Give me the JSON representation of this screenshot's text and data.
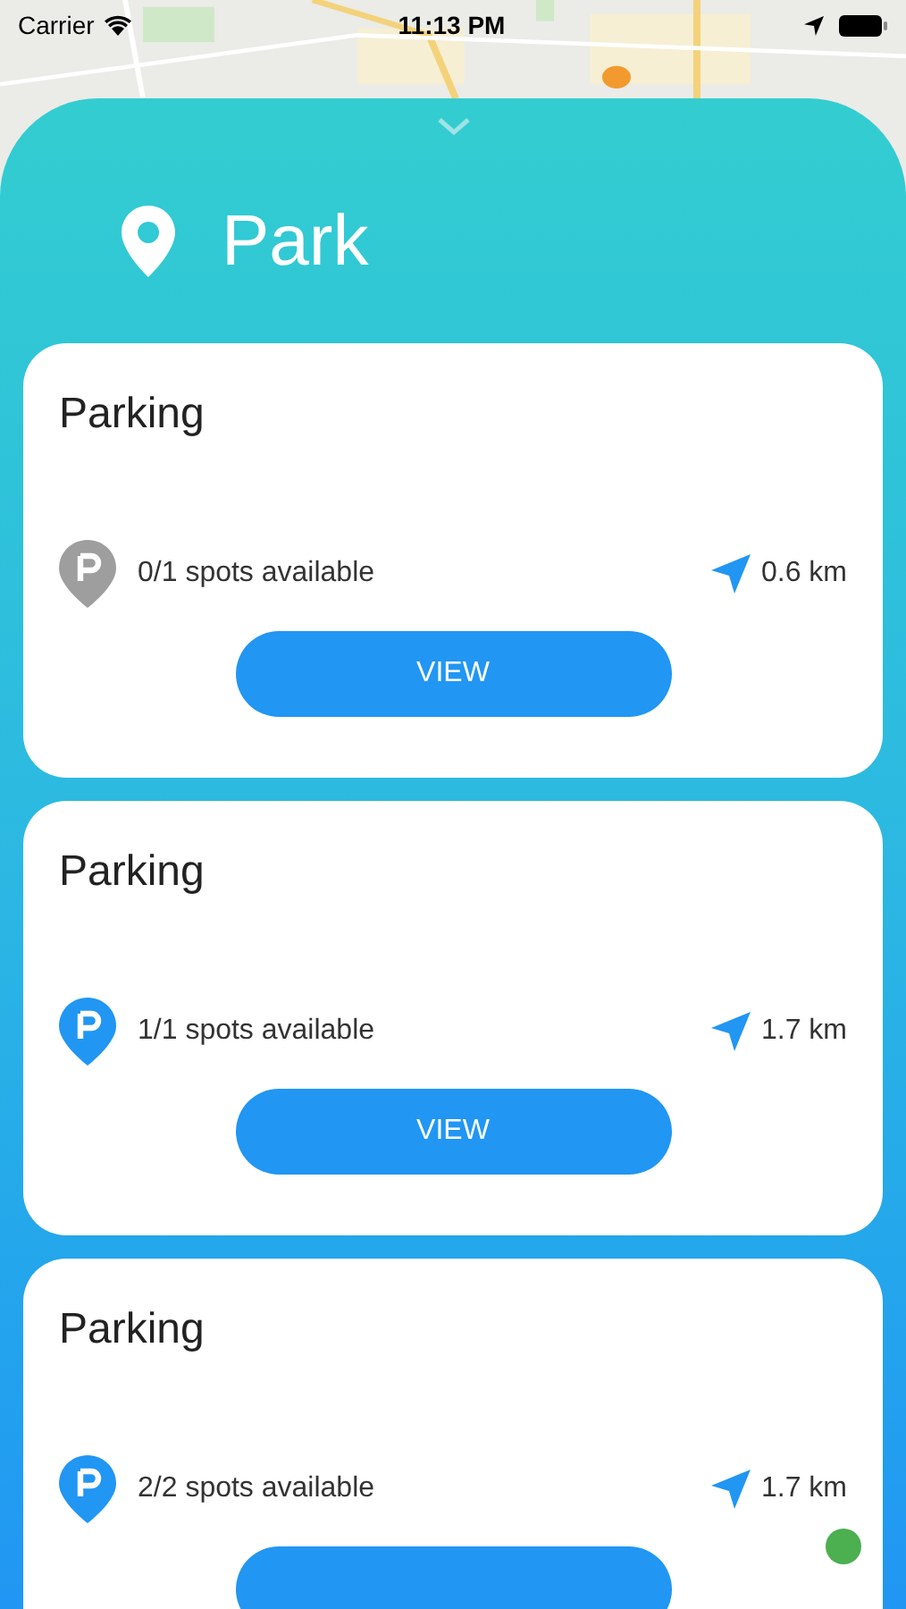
{
  "status_bar": {
    "carrier": "Carrier",
    "time": "11:13 PM"
  },
  "sheet": {
    "title": "Park"
  },
  "cards": [
    {
      "title": "Parking",
      "spots": "0/1 spots available",
      "distance": "0.6 km",
      "color": "#9e9e9e",
      "button": "VIEW"
    },
    {
      "title": "Parking",
      "spots": "1/1 spots available",
      "distance": "1.7 km",
      "color": "#2196f3",
      "button": "VIEW"
    },
    {
      "title": "Parking",
      "spots": "2/2 spots available",
      "distance": "1.7 km",
      "color": "#2196f3"
    }
  ]
}
